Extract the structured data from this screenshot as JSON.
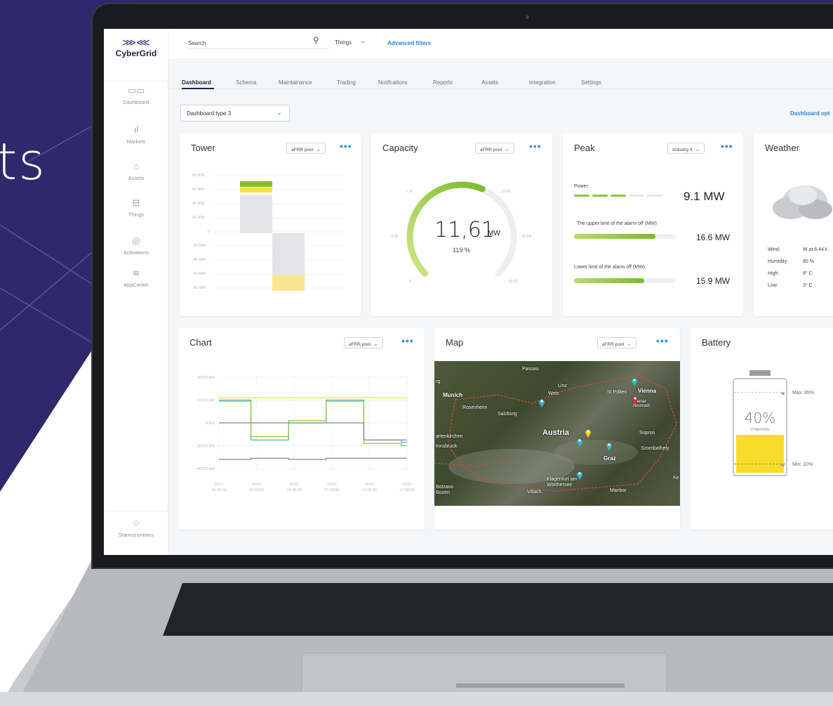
{
  "hero": {
    "text": "ts"
  },
  "app": {
    "logo_name": "CyberGrid"
  },
  "sidebar": {
    "items": [
      {
        "label": "Dashboard",
        "icon": "dashboard-icon"
      },
      {
        "label": "Markets",
        "icon": "markets-icon"
      },
      {
        "label": "Assets",
        "icon": "home-icon"
      },
      {
        "label": "Things",
        "icon": "router-icon"
      },
      {
        "label": "Activations",
        "icon": "activations-icon"
      },
      {
        "label": "AppCenter",
        "icon": "layers-icon"
      }
    ],
    "starred": "Starred entities"
  },
  "topbar": {
    "search_placeholder": "Search",
    "things_label": "Things",
    "advanced_filters": "Advanced filters"
  },
  "tabs": [
    "Dashboard",
    "Schema",
    "Maintainance",
    "Trading",
    "Notifcations",
    "Reports",
    "Assets",
    "Integration",
    "Settings"
  ],
  "dashboard": {
    "type_select": "Dashboard type 3",
    "options_link": "Dashboard opt"
  },
  "tower": {
    "title": "Tower",
    "dropdown": "aFRR pool",
    "y_labels": [
      "80 MW",
      "60 MW",
      "40 MW",
      "20 MW",
      "0",
      "-20 MW",
      "-40 MW",
      "-60 MW",
      "-80 MW"
    ]
  },
  "capacity": {
    "title": "Capacity",
    "dropdown": "aFRR pool",
    "value": "11,61",
    "unit": "MW",
    "percent": "119 %",
    "ticks": [
      "0",
      "3.96",
      "7.92",
      "11.88",
      "15.84",
      "19.81"
    ],
    "fill_fraction": 0.586
  },
  "peak": {
    "title": "Peak",
    "dropdown": "Industry 3",
    "power_label": "Power",
    "power_value": "9.1 MW",
    "upper_label": "The upper limit of the alarm off (MW)",
    "upper_value": "16.6 MW",
    "upper_fraction": 0.8,
    "lower_label": "Lower limit of the alarm off (MW)",
    "lower_value": "15.9 MW",
    "lower_fraction": 0.69
  },
  "weather": {
    "title": "Weather",
    "rows": [
      {
        "k": "Wind:",
        "v": "W at 6.44 k"
      },
      {
        "k": "Humidity:",
        "v": "80 %"
      },
      {
        "k": "High:",
        "v": "8° C"
      },
      {
        "k": "Low:",
        "v": "3° C"
      }
    ]
  },
  "chart_card": {
    "title": "Chart",
    "dropdown": "aFRR pool"
  },
  "chart_data": {
    "type": "line",
    "title": "",
    "xlabel": "",
    "ylabel": "",
    "x": [
      "10/21 16:15:00",
      "10/21 16:30:00",
      "10/21 16:45:00",
      "10/21 17:00:00",
      "10/21 17:15:00",
      "10/21 17:30:00"
    ],
    "y_ticks": [
      "40000 kW",
      "20000 kW",
      "0 kW",
      "-20000 kW",
      "-40000 kW"
    ],
    "ylim": [
      -40000,
      40000
    ],
    "grid": true,
    "series": [
      {
        "color": "#f2e04a",
        "values": [
          22000,
          22000,
          22000,
          22000,
          22000,
          22000
        ]
      },
      {
        "color": "#3db6d9",
        "values": [
          20000,
          -15000,
          0,
          20000,
          -15000,
          -17000
        ]
      },
      {
        "color": "#8dc63f",
        "values": [
          19000,
          -12000,
          2000,
          19000,
          -18000,
          -20000
        ]
      },
      {
        "color": "#888888",
        "values": [
          0,
          0,
          0,
          0,
          -15000,
          -15000
        ]
      },
      {
        "color": "#888888",
        "values": [
          -32000,
          -31000,
          -32000,
          -31000,
          -31000,
          -31000
        ]
      }
    ]
  },
  "map": {
    "title": "Map",
    "dropdown": "aFRR pool",
    "labels": [
      "Passau",
      "Munich",
      "Linz",
      "Wels",
      "St Pölten",
      "Vienna",
      "Wiener Neustadt",
      "Rosenheim",
      "Salzburg",
      "Austria",
      "Sopron",
      "Innsbruck",
      "Graz",
      "Szombathely",
      "Klagenfurt am Wörthersee",
      "Villach",
      "Maribor",
      "Bolzano Bozen",
      "rg",
      "artenkirchen",
      "Ke"
    ]
  },
  "battery": {
    "title": "Battery",
    "percent": "40%",
    "status": "CHARGING",
    "max_label": "Max: 85%",
    "min_label": "Min: 10%",
    "level_fraction": 0.4
  }
}
